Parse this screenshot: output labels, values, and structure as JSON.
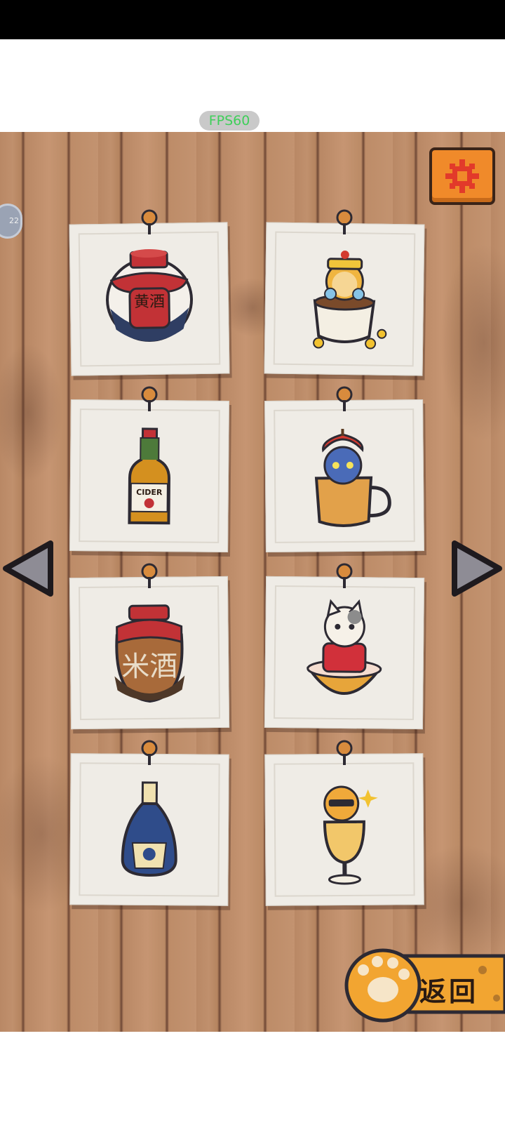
{
  "system": {
    "fps_label": "FPS60"
  },
  "side_bubble": {
    "text": "22"
  },
  "settings": {
    "icon": "gear-icon",
    "color": "#f08a2a"
  },
  "cards": [
    {
      "id": "yellow-wine-jar",
      "label": "黄酒"
    },
    {
      "id": "cat-in-teacup"
    },
    {
      "id": "cider-bottle",
      "label": "CIDER"
    },
    {
      "id": "cat-apple-mug"
    },
    {
      "id": "clay-wine-jar",
      "label": "米酒"
    },
    {
      "id": "cat-red-jacket-bowl"
    },
    {
      "id": "blue-liquor-bottle"
    },
    {
      "id": "cat-sunglasses-glass"
    }
  ],
  "navigation": {
    "prev_icon": "left-arrow-icon",
    "next_icon": "right-arrow-icon"
  },
  "back_button": {
    "label": "返回",
    "icon": "cat-paw-icon",
    "color": "#f2a531"
  }
}
